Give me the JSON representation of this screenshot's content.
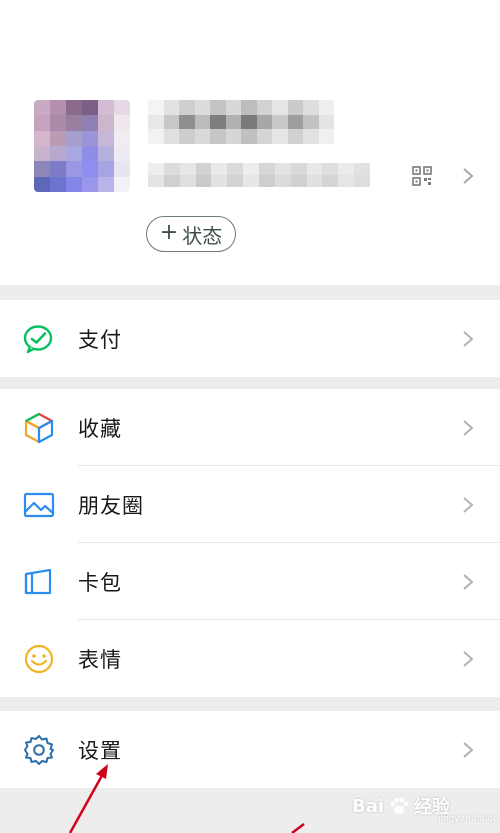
{
  "profile": {
    "status_button": {
      "plus": "+",
      "label": "状态"
    }
  },
  "menu": {
    "pay": {
      "label": "支付",
      "icon": "wechat-pay-icon"
    },
    "favorites": {
      "label": "收藏",
      "icon": "favorites-cube-icon"
    },
    "moments": {
      "label": "朋友圈",
      "icon": "moments-picture-icon"
    },
    "cards": {
      "label": "卡包",
      "icon": "card-wallet-icon"
    },
    "stickers": {
      "label": "表情",
      "icon": "smiley-icon"
    },
    "settings": {
      "label": "设置",
      "icon": "gear-icon"
    }
  },
  "watermark": {
    "text": "Bai",
    "text2": "经验",
    "sub": "jingyan.baidu.com"
  },
  "colors": {
    "background": "#ededed",
    "pay_green": "#07c160",
    "favorites": [
      "#f5a623",
      "#2d8cf0",
      "#e64340",
      "#07c160"
    ],
    "moments_blue": "#2d8cf0",
    "cards_blue": "#2d8cf0",
    "stickers_yellow": "#f0b429",
    "settings_blue": "#2d6ea8",
    "annotation_arrow": "#d0021b"
  }
}
